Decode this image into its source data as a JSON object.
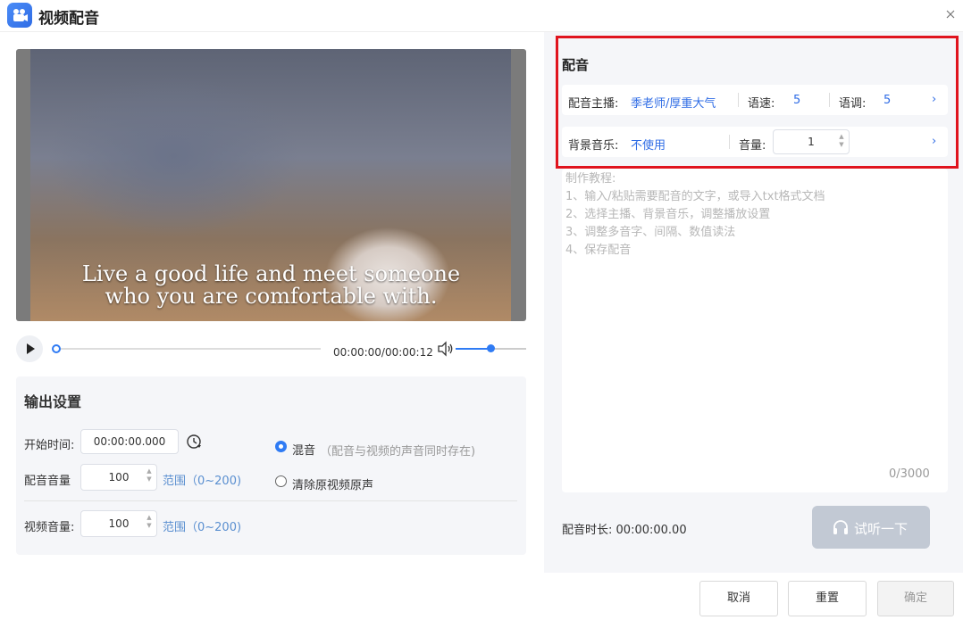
{
  "window": {
    "title": "视频配音",
    "icon": "video-dub-app-icon",
    "close_icon": "close-icon"
  },
  "video": {
    "caption_line1": "Live a good life and meet someone",
    "caption_line2": "who you are comfortable with.",
    "time": "00:00:00/00:00:12",
    "progress_fraction": 0.0,
    "volume_fraction": 0.5
  },
  "output": {
    "title": "输出设置",
    "start_label": "开始时间:",
    "start_value": "00:00:00.000",
    "dub_volume_label": "配音音量",
    "dub_volume_value": "100",
    "range_hint": "范围（0~200)",
    "video_volume_label": "视频音量:",
    "video_volume_value": "100",
    "range_hint2": "范围（0~200)",
    "mix_label": "混音",
    "mix_hint": "（配音与视频的声音同时存在)",
    "clear_label": "清除原视频原声",
    "mix_selected": true
  },
  "dub": {
    "title": "配音",
    "anchor_label": "配音主播:",
    "anchor_value": "季老师/厚重大气",
    "speed_label": "语速:",
    "speed_value": "5",
    "pitch_label": "语调:",
    "pitch_value": "5",
    "bgm_label": "背景音乐:",
    "bgm_value": "不使用",
    "bgm_volume_label": "音量:",
    "bgm_volume_value": "1",
    "tutorial": [
      "制作教程:",
      "1、输入/粘贴需要配音的文字，或导入txt格式文档",
      "2、选择主播、背景音乐，调整播放设置",
      "3、调整多音字、间隔、数值读法",
      "4、保存配音"
    ],
    "counter": "0/3000",
    "duration_label": "配音时长:",
    "duration_value": "00:00:00.00",
    "listen_button": "试听一下"
  },
  "footer": {
    "cancel": "取消",
    "reset": "重置",
    "confirm": "确定"
  },
  "colors": {
    "accent": "#2f7bf4",
    "link_blue": "#2f6ce5",
    "highlight_red": "#e0141e",
    "disabled_button": "#c2c9d4"
  }
}
